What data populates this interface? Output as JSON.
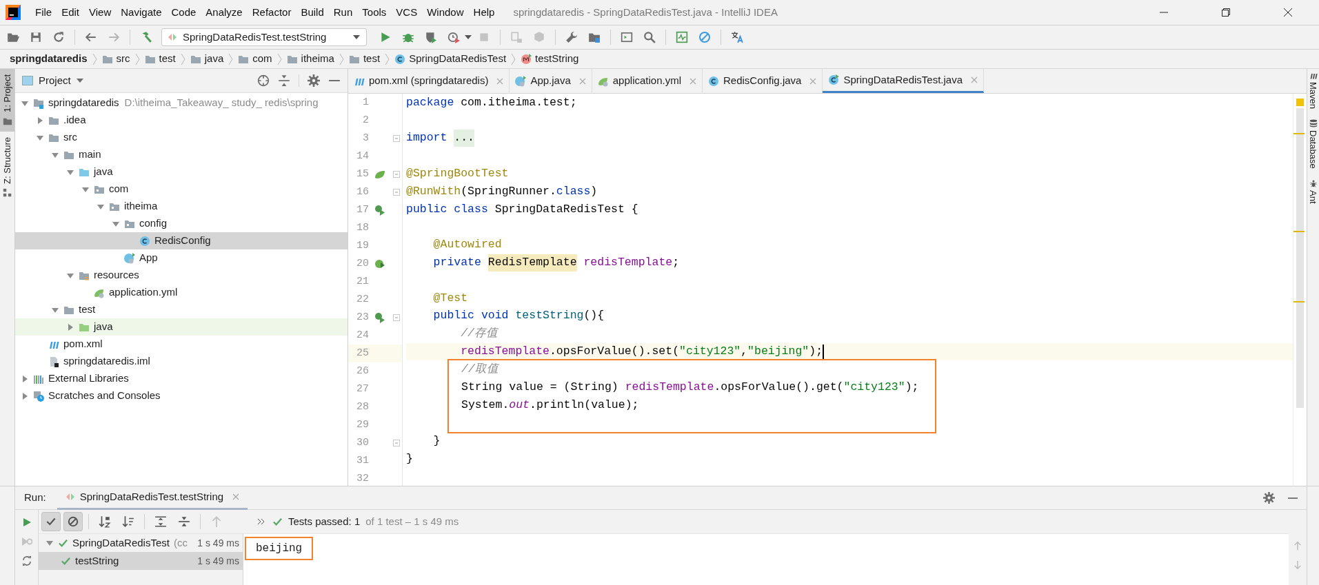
{
  "window": {
    "title": "springdataredis - SpringDataRedisTest.java - IntelliJ IDEA"
  },
  "menu": [
    "File",
    "Edit",
    "View",
    "Navigate",
    "Code",
    "Analyze",
    "Refactor",
    "Build",
    "Run",
    "Tools",
    "VCS",
    "Window",
    "Help"
  ],
  "toolbar": {
    "run_configuration": "SpringDataRedisTest.testString"
  },
  "breadcrumbs": [
    {
      "label": "springdataredis",
      "kind": "project"
    },
    {
      "label": "src",
      "kind": "folder"
    },
    {
      "label": "test",
      "kind": "folder"
    },
    {
      "label": "java",
      "kind": "folder"
    },
    {
      "label": "com",
      "kind": "folder"
    },
    {
      "label": "itheima",
      "kind": "folder"
    },
    {
      "label": "test",
      "kind": "folder"
    },
    {
      "label": "SpringDataRedisTest",
      "kind": "class"
    },
    {
      "label": "testString",
      "kind": "method"
    }
  ],
  "left_strip": [
    {
      "label": "1: Project",
      "selected": true
    },
    {
      "label": "Z: Structure",
      "selected": false
    }
  ],
  "right_strip": [
    {
      "label": "Maven",
      "kind": "maven"
    },
    {
      "label": "Database",
      "kind": "database"
    },
    {
      "label": "Ant",
      "kind": "ant"
    }
  ],
  "project": {
    "title": "Project",
    "tree": [
      {
        "label": "springdataredis",
        "path": "D:\\itheima_Takeaway_ study_ redis\\spring",
        "kind": "module",
        "expanded": true,
        "selected": false,
        "children": [
          {
            "label": ".idea",
            "kind": "folder",
            "expanded": false,
            "selected": false
          },
          {
            "label": "src",
            "kind": "folder",
            "expanded": true,
            "selected": false,
            "children": [
              {
                "label": "main",
                "kind": "folder",
                "expanded": true,
                "selected": false,
                "children": [
                  {
                    "label": "java",
                    "kind": "source-folder",
                    "expanded": true,
                    "selected": false,
                    "children": [
                      {
                        "label": "com",
                        "kind": "package",
                        "expanded": true,
                        "selected": false,
                        "children": [
                          {
                            "label": "itheima",
                            "kind": "package",
                            "expanded": true,
                            "selected": false,
                            "children": [
                              {
                                "label": "config",
                                "kind": "package",
                                "expanded": true,
                                "selected": false,
                                "children": [
                                  {
                                    "label": "RedisConfig",
                                    "kind": "class",
                                    "selected": true
                                  }
                                ]
                              },
                              {
                                "label": "App",
                                "kind": "spring-class",
                                "selected": false
                              }
                            ]
                          }
                        ]
                      }
                    ]
                  },
                  {
                    "label": "resources",
                    "kind": "resources",
                    "expanded": true,
                    "selected": false,
                    "children": [
                      {
                        "label": "application.yml",
                        "kind": "yml",
                        "selected": false
                      }
                    ]
                  }
                ]
              },
              {
                "label": "test",
                "kind": "folder",
                "expanded": true,
                "selected": false,
                "children": [
                  {
                    "label": "java",
                    "kind": "test-folder",
                    "expanded": false,
                    "selected": false
                  }
                ]
              }
            ]
          },
          {
            "label": "pom.xml",
            "kind": "maven",
            "selected": false
          },
          {
            "label": "springdataredis.iml",
            "kind": "iml",
            "selected": false
          }
        ]
      },
      {
        "label": "External Libraries",
        "kind": "libraries",
        "expanded": false,
        "selected": false
      },
      {
        "label": "Scratches and Consoles",
        "kind": "scratches",
        "expanded": false,
        "selected": false
      }
    ]
  },
  "editor": {
    "tabs": [
      {
        "label": "pom.xml (springdataredis)",
        "kind": "maven",
        "selected": false
      },
      {
        "label": "App.java",
        "kind": "spring-class",
        "selected": false
      },
      {
        "label": "application.yml",
        "kind": "yml",
        "selected": false
      },
      {
        "label": "RedisConfig.java",
        "kind": "class",
        "selected": false
      },
      {
        "label": "SpringDataRedisTest.java",
        "kind": "test-class",
        "selected": true
      }
    ],
    "lines": [
      {
        "number": "1",
        "tokens": [
          {
            "kind": "keyword",
            "text": "package"
          },
          {
            "kind": "plain",
            "text": " com.itheima.test;"
          }
        ]
      },
      {
        "number": "2"
      },
      {
        "number": "3",
        "fold": true,
        "tokens": [
          {
            "kind": "keyword",
            "text": "import "
          },
          {
            "kind": "folded",
            "text": "..."
          }
        ]
      },
      {
        "number": "14"
      },
      {
        "number": "15",
        "kind": "spring",
        "fold": true,
        "tokens": [
          {
            "kind": "annotation",
            "text": "@SpringBootTest"
          }
        ]
      },
      {
        "number": "16",
        "fold": true,
        "tokens": [
          {
            "kind": "annotation",
            "text": "@RunWith"
          },
          {
            "kind": "plain",
            "text": "(SpringRunner."
          },
          {
            "kind": "keyword",
            "text": "class"
          },
          {
            "kind": "plain",
            "text": ")"
          }
        ]
      },
      {
        "number": "17",
        "kind": "run",
        "tokens": [
          {
            "kind": "keyword",
            "text": "public class"
          },
          {
            "kind": "plain",
            "text": " SpringDataRedisTest {"
          }
        ]
      },
      {
        "number": "18"
      },
      {
        "number": "19",
        "tokens": [
          {
            "kind": "annotation",
            "text": "    @Autowired"
          }
        ]
      },
      {
        "number": "20",
        "kind": "bean",
        "tokens": [
          {
            "kind": "keyword",
            "text": "    private "
          },
          {
            "kind": "reference",
            "text": "RedisTemplate"
          },
          {
            "kind": "field",
            "text": " redisTemplate"
          },
          {
            "kind": "plain",
            "text": ";"
          }
        ]
      },
      {
        "number": "21"
      },
      {
        "number": "22",
        "tokens": [
          {
            "kind": "annotation",
            "text": "    @Test"
          }
        ]
      },
      {
        "number": "23",
        "kind": "run",
        "fold": true,
        "tokens": [
          {
            "kind": "keyword",
            "text": "    public void "
          },
          {
            "kind": "method",
            "text": "testString"
          },
          {
            "kind": "plain",
            "text": "(){"
          }
        ]
      },
      {
        "number": "24",
        "tokens": [
          {
            "kind": "comment",
            "text": "        //存值"
          }
        ]
      },
      {
        "number": "25",
        "current": true,
        "tokens": [
          {
            "kind": "field",
            "text": "        redisTemplate"
          },
          {
            "kind": "plain",
            "text": ".opsForValue().set("
          },
          {
            "kind": "string",
            "text": "\"city123\""
          },
          {
            "kind": "plain",
            "text": ","
          },
          {
            "kind": "string",
            "text": "\"beijing\""
          },
          {
            "kind": "plain",
            "text": ");"
          }
        ]
      },
      {
        "number": "26",
        "boxed": true,
        "tokens": [
          {
            "kind": "comment",
            "text": "//取值"
          }
        ]
      },
      {
        "number": "27",
        "boxed": true,
        "tokens": [
          {
            "kind": "plain",
            "text": "String value = (String) "
          },
          {
            "kind": "field",
            "text": "redisTemplate"
          },
          {
            "kind": "plain",
            "text": ".opsForValue().get("
          },
          {
            "kind": "string",
            "text": "\"city123\""
          },
          {
            "kind": "plain",
            "text": ");"
          }
        ]
      },
      {
        "number": "28",
        "boxed": true,
        "tokens": [
          {
            "kind": "plain",
            "text": "System."
          },
          {
            "kind": "static",
            "text": "out"
          },
          {
            "kind": "plain",
            "text": ".println(value);"
          }
        ]
      },
      {
        "number": "29",
        "boxed": true
      },
      {
        "number": "30",
        "fold": true,
        "tokens": [
          {
            "kind": "plain",
            "text": "    }"
          }
        ]
      },
      {
        "number": "31",
        "tokens": [
          {
            "kind": "plain",
            "text": "}"
          }
        ]
      },
      {
        "number": "32"
      }
    ]
  },
  "run": {
    "label": "Run:",
    "tab": "SpringDataRedisTest.testString",
    "filter_toggles": [
      {
        "kind": "passed",
        "selected": true
      },
      {
        "kind": "ignored",
        "selected": true
      }
    ],
    "status": {
      "summary": "Tests passed: 1",
      "detail": "of 1 test – 1 s 49 ms"
    },
    "tests": [
      {
        "label": "SpringDataRedisTest",
        "note": "(cc",
        "time": "1 s 49 ms",
        "expanded": true,
        "selected": false,
        "children": [
          {
            "label": "testString",
            "time": "1 s 49 ms",
            "selected": true
          }
        ]
      }
    ],
    "output": {
      "text": "beijing",
      "boxed": true
    }
  }
}
